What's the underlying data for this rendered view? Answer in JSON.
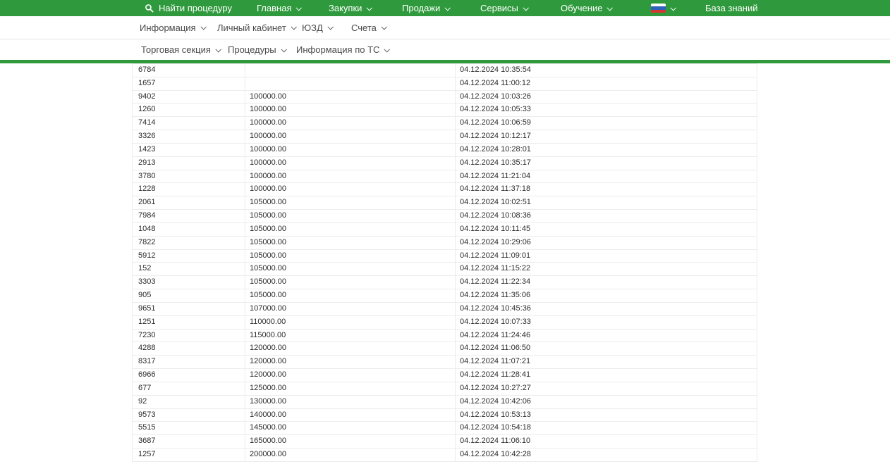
{
  "colors": {
    "accent_green": "#2f9a3d",
    "flag_blue": "#2f63b8",
    "flag_red": "#d63631"
  },
  "topnav": {
    "search_label": "Найти процедуру",
    "items": [
      {
        "label": "Главная"
      },
      {
        "label": "Закупки"
      },
      {
        "label": "Продажи"
      },
      {
        "label": "Сервисы"
      },
      {
        "label": "Обучение"
      }
    ],
    "language_flag": "russia-flag",
    "knowledge_base_label": "База знаний"
  },
  "subnav_account": {
    "items": [
      {
        "label": "Информация"
      },
      {
        "label": "Личный кабинет"
      },
      {
        "label": "ЮЗД"
      },
      {
        "label": "Счета"
      }
    ]
  },
  "subnav_section": {
    "items": [
      {
        "label": "Торговая секция"
      },
      {
        "label": "Процедуры"
      },
      {
        "label": "Информация по ТС"
      }
    ]
  },
  "table": {
    "rows": [
      {
        "id": "6784",
        "amount": "",
        "datetime": "04.12.2024 10:35:54"
      },
      {
        "id": "1657",
        "amount": "",
        "datetime": "04.12.2024 11:00:12"
      },
      {
        "id": "9402",
        "amount": "100000.00",
        "datetime": "04.12.2024 10:03:26"
      },
      {
        "id": "1260",
        "amount": "100000.00",
        "datetime": "04.12.2024 10:05:33"
      },
      {
        "id": "7414",
        "amount": "100000.00",
        "datetime": "04.12.2024 10:06:59"
      },
      {
        "id": "3326",
        "amount": "100000.00",
        "datetime": "04.12.2024 10:12:17"
      },
      {
        "id": "1423",
        "amount": "100000.00",
        "datetime": "04.12.2024 10:28:01"
      },
      {
        "id": "2913",
        "amount": "100000.00",
        "datetime": "04.12.2024 10:35:17"
      },
      {
        "id": "3780",
        "amount": "100000.00",
        "datetime": "04.12.2024 11:21:04"
      },
      {
        "id": "1228",
        "amount": "100000.00",
        "datetime": "04.12.2024 11:37:18"
      },
      {
        "id": "2061",
        "amount": "105000.00",
        "datetime": "04.12.2024 10:02:51"
      },
      {
        "id": "7984",
        "amount": "105000.00",
        "datetime": "04.12.2024 10:08:36"
      },
      {
        "id": "1048",
        "amount": "105000.00",
        "datetime": "04.12.2024 10:11:45"
      },
      {
        "id": "7822",
        "amount": "105000.00",
        "datetime": "04.12.2024 10:29:06"
      },
      {
        "id": "5912",
        "amount": "105000.00",
        "datetime": "04.12.2024 11:09:01"
      },
      {
        "id": "152",
        "amount": "105000.00",
        "datetime": "04.12.2024 11:15:22"
      },
      {
        "id": "3303",
        "amount": "105000.00",
        "datetime": "04.12.2024 11:22:34"
      },
      {
        "id": "905",
        "amount": "105000.00",
        "datetime": "04.12.2024 11:35:06"
      },
      {
        "id": "9651",
        "amount": "107000.00",
        "datetime": "04.12.2024 10:45:36"
      },
      {
        "id": "1251",
        "amount": "110000.00",
        "datetime": "04.12.2024 10:07:33"
      },
      {
        "id": "7230",
        "amount": "115000.00",
        "datetime": "04.12.2024 11:24:46"
      },
      {
        "id": "4288",
        "amount": "120000.00",
        "datetime": "04.12.2024 11:06:50"
      },
      {
        "id": "8317",
        "amount": "120000.00",
        "datetime": "04.12.2024 11:07:21"
      },
      {
        "id": "6966",
        "amount": "120000.00",
        "datetime": "04.12.2024 11:28:41"
      },
      {
        "id": "677",
        "amount": "125000.00",
        "datetime": "04.12.2024 10:27:27"
      },
      {
        "id": "92",
        "amount": "130000.00",
        "datetime": "04.12.2024 10:42:06"
      },
      {
        "id": "9573",
        "amount": "140000.00",
        "datetime": "04.12.2024 10:53:13"
      },
      {
        "id": "5515",
        "amount": "145000.00",
        "datetime": "04.12.2024 10:54:18"
      },
      {
        "id": "3687",
        "amount": "165000.00",
        "datetime": "04.12.2024 11:06:10"
      },
      {
        "id": "1257",
        "amount": "200000.00",
        "datetime": "04.12.2024 10:42:28"
      }
    ]
  }
}
